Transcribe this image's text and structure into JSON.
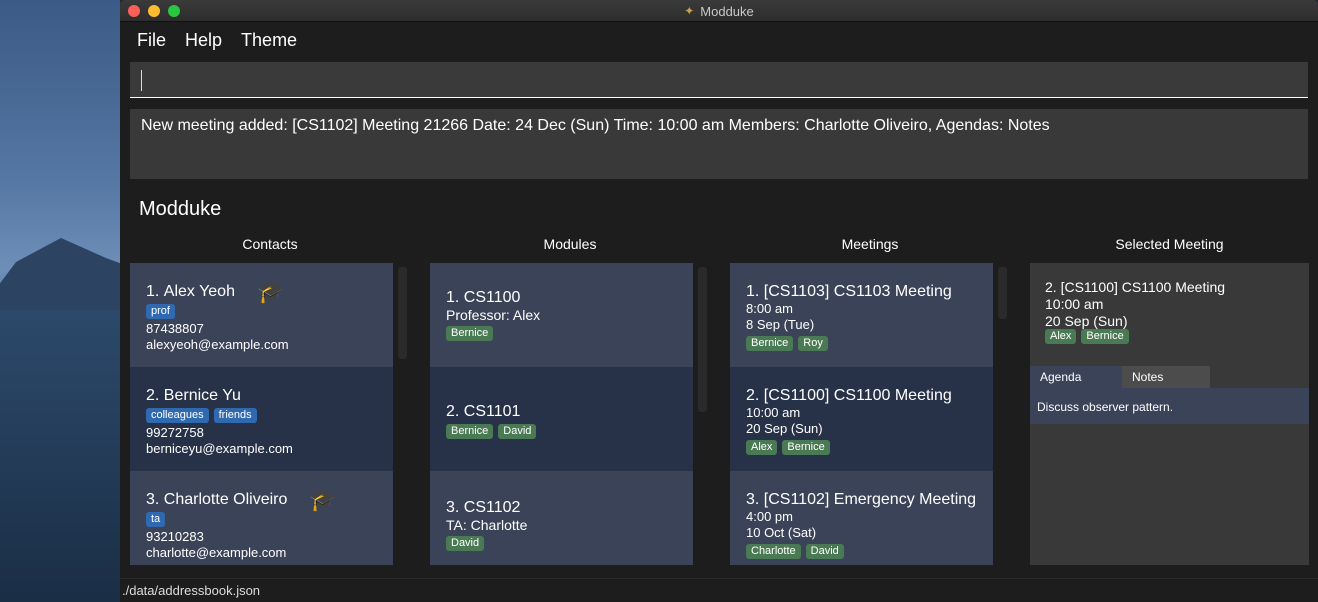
{
  "window": {
    "title": "Modduke"
  },
  "menu": {
    "file": "File",
    "help": "Help",
    "theme": "Theme"
  },
  "command": {
    "value": "",
    "placeholder": ""
  },
  "result": {
    "text": "New meeting added: [CS1102] Meeting 21266 Date: 24 Dec (Sun) Time: 10:00 am Members: Charlotte Oliveiro,  Agendas:  Notes"
  },
  "app": {
    "heading": "Modduke"
  },
  "columns": {
    "contacts": "Contacts",
    "modules": "Modules",
    "meetings": "Meetings",
    "selected": "Selected Meeting"
  },
  "contacts": [
    {
      "index": "1.",
      "name": "Alex Yeoh",
      "tags": [
        "prof"
      ],
      "phone": "87438807",
      "email": "alexyeoh@example.com",
      "icon": "graduation-cap"
    },
    {
      "index": "2.",
      "name": "Bernice Yu",
      "tags": [
        "colleagues",
        "friends"
      ],
      "phone": "99272758",
      "email": "berniceyu@example.com"
    },
    {
      "index": "3.",
      "name": "Charlotte Oliveiro",
      "tags": [
        "ta"
      ],
      "phone": "93210283",
      "email": "charlotte@example.com",
      "icon": "graduation-cap"
    }
  ],
  "modules": [
    {
      "index": "1.",
      "code": "CS1100",
      "role": "Professor: Alex",
      "members": [
        "Bernice"
      ]
    },
    {
      "index": "2.",
      "code": "CS1101",
      "role": "",
      "members": [
        "Bernice",
        "David"
      ]
    },
    {
      "index": "3.",
      "code": "CS1102",
      "role": "TA: Charlotte",
      "members": [
        "David"
      ]
    }
  ],
  "meetings": [
    {
      "index": "1.",
      "title": "[CS1103] CS1103 Meeting",
      "time": "8:00 am",
      "date": "8 Sep (Tue)",
      "members": [
        "Bernice",
        "Roy"
      ]
    },
    {
      "index": "2.",
      "title": "[CS1100] CS1100 Meeting",
      "time": "10:00 am",
      "date": "20 Sep (Sun)",
      "members": [
        "Alex",
        "Bernice"
      ]
    },
    {
      "index": "3.",
      "title": "[CS1102] Emergency Meeting",
      "time": "4:00 pm",
      "date": "10 Oct (Sat)",
      "members": [
        "Charlotte",
        "David"
      ]
    }
  ],
  "selected": {
    "title": "2.  [CS1100] CS1100 Meeting",
    "time": "10:00 am",
    "date": "20 Sep (Sun)",
    "members": [
      "Alex",
      "Bernice"
    ],
    "tabs": {
      "agenda": "Agenda",
      "notes": "Notes"
    },
    "agenda_text": "Discuss observer pattern."
  },
  "status": {
    "path": "./data/addressbook.json"
  },
  "colors": {
    "tag_blue": "#2f69b0",
    "tag_green": "#4a7a54",
    "card_light": "#3b4358",
    "card_dark": "#273148",
    "icon_orange": "#f0a224"
  }
}
